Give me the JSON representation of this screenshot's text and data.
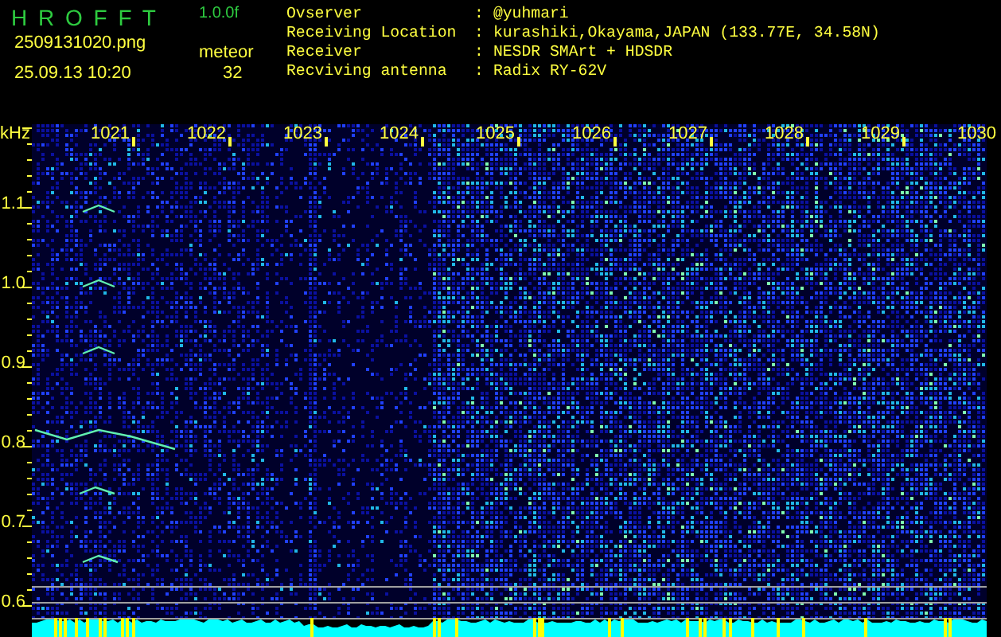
{
  "header": {
    "app_name": "H R O F F T",
    "version": "1.0.0f",
    "file_name": "2509131020.png",
    "mode": "meteor",
    "timestamp": "25.09.13 10:20",
    "count": "32"
  },
  "info": [
    {
      "label": "Ovserver",
      "separator": ":",
      "value": "@yuhmari"
    },
    {
      "label": "Receiving Location",
      "separator": ":",
      "value": "kurashiki,Okayama,JAPAN (133.77E, 34.58N)"
    },
    {
      "label": "Receiver",
      "separator": ":",
      "value": "NESDR SMArt + HDSDR"
    },
    {
      "label": "Recviving antenna",
      "separator": ":",
      "value": "Radix RY-62V"
    }
  ],
  "plot": {
    "unit": "kHz",
    "x_labels": [
      "1021",
      "1022",
      "1023",
      "1024",
      "1025",
      "1026",
      "1027",
      "1028",
      "1029",
      "1030"
    ],
    "y_labels": [
      "1.1",
      "1.0",
      "0.9",
      "0.8",
      "0.7",
      "0.6"
    ]
  }
}
